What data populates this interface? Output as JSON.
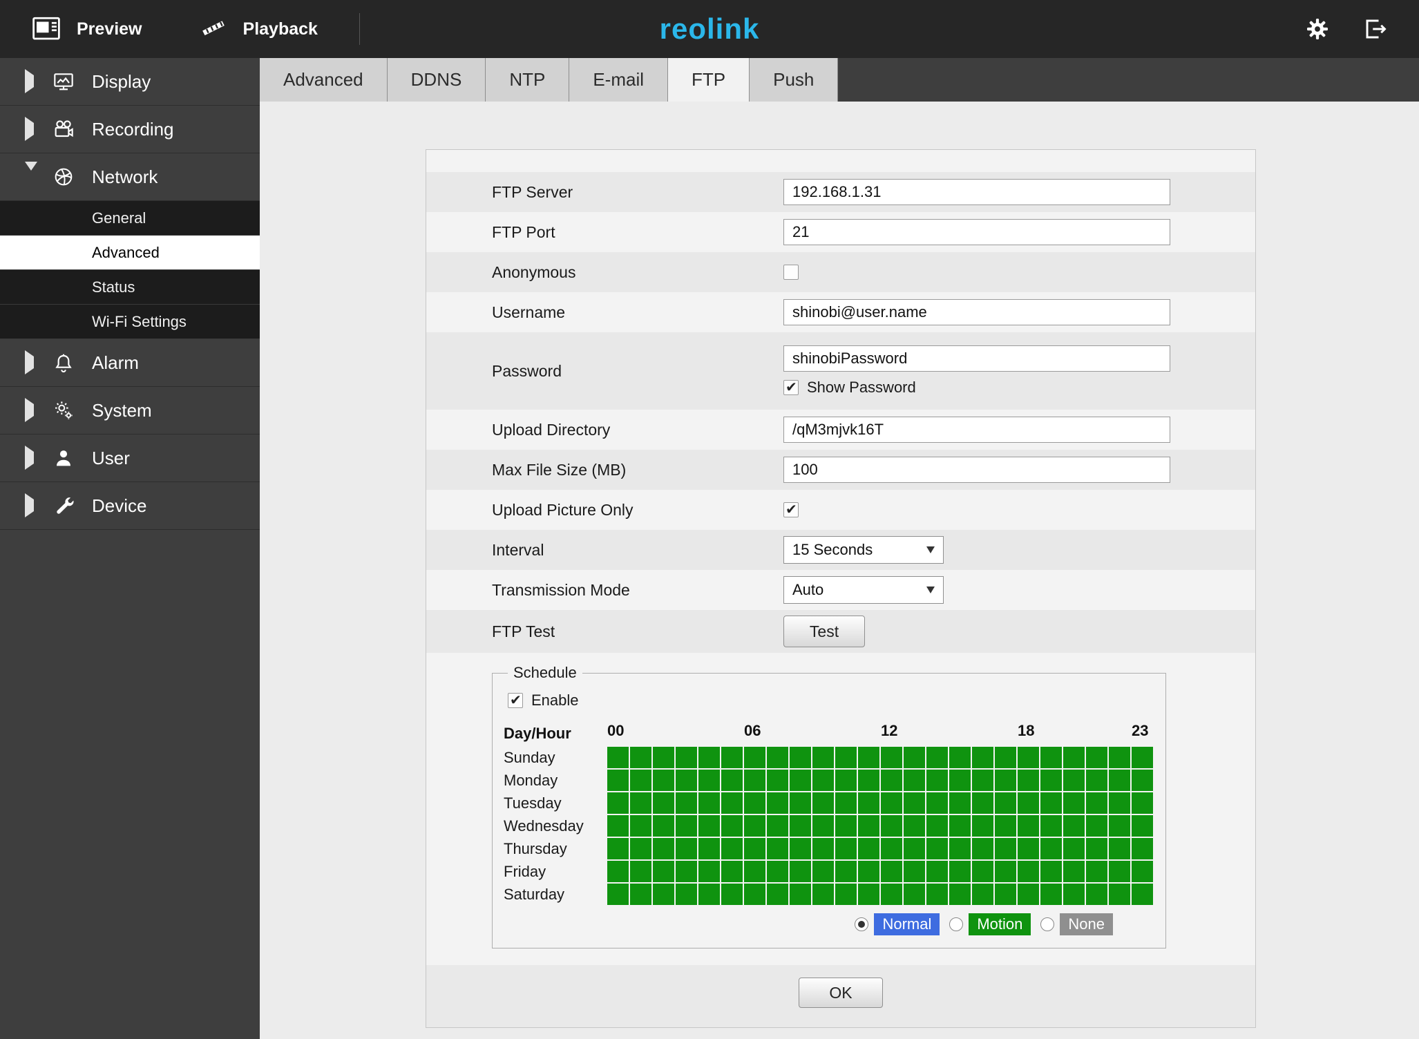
{
  "topbar": {
    "preview_label": "Preview",
    "playback_label": "Playback",
    "logo": "reolink"
  },
  "sidebar": {
    "items": [
      {
        "label": "Display"
      },
      {
        "label": "Recording"
      },
      {
        "label": "Network",
        "expanded": true,
        "children": [
          {
            "label": "General"
          },
          {
            "label": "Advanced",
            "active": true
          },
          {
            "label": "Status"
          },
          {
            "label": "Wi-Fi Settings"
          }
        ]
      },
      {
        "label": "Alarm"
      },
      {
        "label": "System"
      },
      {
        "label": "User"
      },
      {
        "label": "Device"
      }
    ]
  },
  "tabs": [
    {
      "label": "Advanced"
    },
    {
      "label": "DDNS"
    },
    {
      "label": "NTP"
    },
    {
      "label": "E-mail"
    },
    {
      "label": "FTP",
      "active": true
    },
    {
      "label": "Push"
    }
  ],
  "form": {
    "ftp_server": {
      "label": "FTP Server",
      "value": "192.168.1.31"
    },
    "ftp_port": {
      "label": "FTP Port",
      "value": "21"
    },
    "anonymous": {
      "label": "Anonymous",
      "checked": false
    },
    "username": {
      "label": "Username",
      "value": "shinobi@user.name"
    },
    "password": {
      "label": "Password",
      "value": "shinobiPassword",
      "show_password_label": "Show Password",
      "show_password_checked": true
    },
    "upload_directory": {
      "label": "Upload Directory",
      "value": "/qM3mjvk16T"
    },
    "max_file_size": {
      "label": "Max File Size (MB)",
      "value": "100"
    },
    "upload_picture_only": {
      "label": "Upload Picture Only",
      "checked": true
    },
    "interval": {
      "label": "Interval",
      "value": "15 Seconds"
    },
    "transmission_mode": {
      "label": "Transmission Mode",
      "value": "Auto"
    },
    "ftp_test": {
      "label": "FTP Test",
      "button_label": "Test"
    }
  },
  "schedule": {
    "legend": "Schedule",
    "enable_label": "Enable",
    "enable_checked": true,
    "header_label": "Day/Hour",
    "hour_labels": [
      {
        "label": "00",
        "column": 0
      },
      {
        "label": "06",
        "column": 6
      },
      {
        "label": "12",
        "column": 12
      },
      {
        "label": "18",
        "column": 18
      },
      {
        "label": "23",
        "column": 23
      }
    ],
    "days": [
      "Sunday",
      "Monday",
      "Tuesday",
      "Wednesday",
      "Thursday",
      "Friday",
      "Saturday"
    ],
    "columns": 24,
    "cells_fill": "motion-all",
    "cell_color": "#0f930f",
    "modes": [
      {
        "label": "Normal",
        "color": "#3e6ce0",
        "selected": true
      },
      {
        "label": "Motion",
        "color": "#0f930f",
        "selected": false
      },
      {
        "label": "None",
        "color": "#8f8f8f",
        "selected": false
      }
    ]
  },
  "ok_button_label": "OK"
}
